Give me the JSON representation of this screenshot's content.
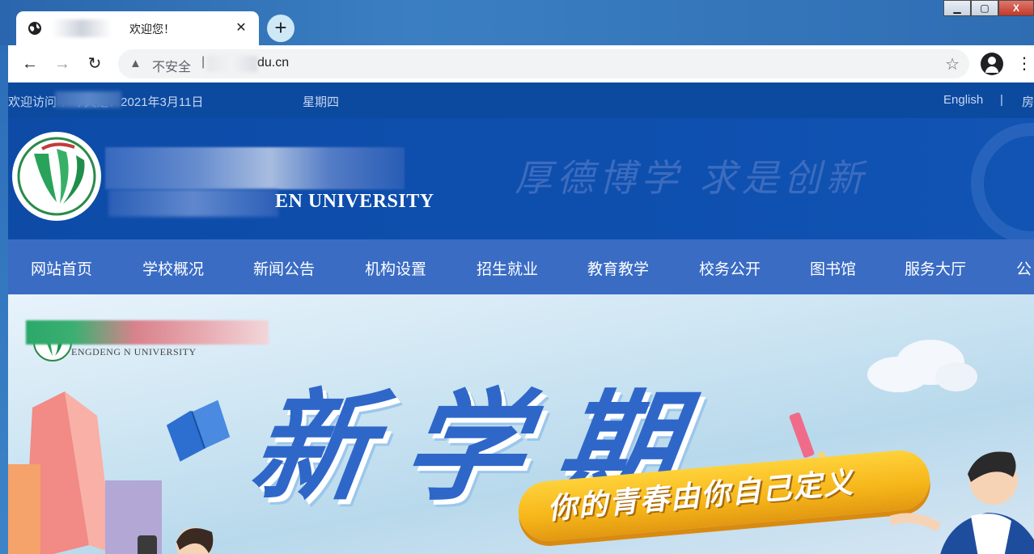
{
  "browser": {
    "tab": {
      "title": "欢迎您！",
      "close_label": "✕"
    },
    "new_tab_label": "+",
    "window_controls": {
      "minimize": "▁",
      "maximize": "▢",
      "close": "X"
    },
    "toolbar": {
      "back": "←",
      "forward": "→",
      "reload": "↻",
      "security_label": "不安全",
      "url": "du.cn",
      "menu": "⋮"
    }
  },
  "page": {
    "topbar": {
      "welcome": "欢迎访问              ！今天是：2021年3月11日",
      "weekday": "星期四",
      "english_link": "English",
      "separator": "|",
      "more_link": "房"
    },
    "header": {
      "english_name": "EN UNIVERSITY",
      "motto": "厚德博学 求是创新"
    },
    "nav": [
      "网站首页",
      "学校概况",
      "新闻公告",
      "机构设置",
      "招生就业",
      "教育教学",
      "校务公开",
      "图书馆",
      "服务大厅",
      "公"
    ],
    "banner": {
      "logo_subtitle": "ENGDENG    N UNIVERSITY",
      "headline": "新学期",
      "slogan": "你的青春由你自己定义"
    }
  },
  "colors": {
    "topbar_bg": "#0c4aa0",
    "header_bg": "#0d4ba7",
    "nav_bg": "#3a6cc4",
    "headline": "#2f67c9",
    "ribbon": "#f5b519"
  }
}
